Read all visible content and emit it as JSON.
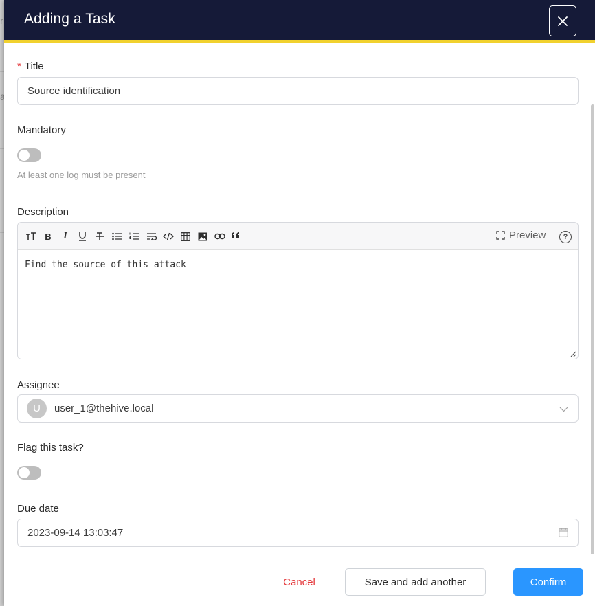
{
  "backdrop": {
    "char1": "r",
    "char2": "a"
  },
  "header": {
    "title": "Adding a Task",
    "close_icon": "close-icon"
  },
  "form": {
    "title": {
      "required_mark": "*",
      "label": "Title",
      "value": "Source identification"
    },
    "mandatory": {
      "label": "Mandatory",
      "enabled": false,
      "helper": "At least one log must be present"
    },
    "description": {
      "label": "Description",
      "toolbar_icons": [
        "text-size-icon",
        "bold-icon",
        "italic-icon",
        "underline-icon",
        "strikethrough-icon",
        "bullet-list-icon",
        "ordered-list-icon",
        "wrap-icon",
        "code-icon",
        "table-icon",
        "image-icon",
        "link-icon",
        "quote-icon"
      ],
      "preview_label": "Preview",
      "help_label": "?",
      "text": "Find the source of this attack"
    },
    "assignee": {
      "label": "Assignee",
      "avatar_initial": "U",
      "value": "user_1@thehive.local"
    },
    "flag": {
      "label": "Flag this task?",
      "enabled": false
    },
    "due_date": {
      "label": "Due date",
      "value": "2023-09-14 13:03:47"
    }
  },
  "footer": {
    "cancel_label": "Cancel",
    "save_add_label": "Save and add another",
    "confirm_label": "Confirm"
  },
  "colors": {
    "header_bg": "#151a38",
    "header_accent": "#f1d12e",
    "primary": "#2a96ff",
    "danger": "#e4393c"
  }
}
